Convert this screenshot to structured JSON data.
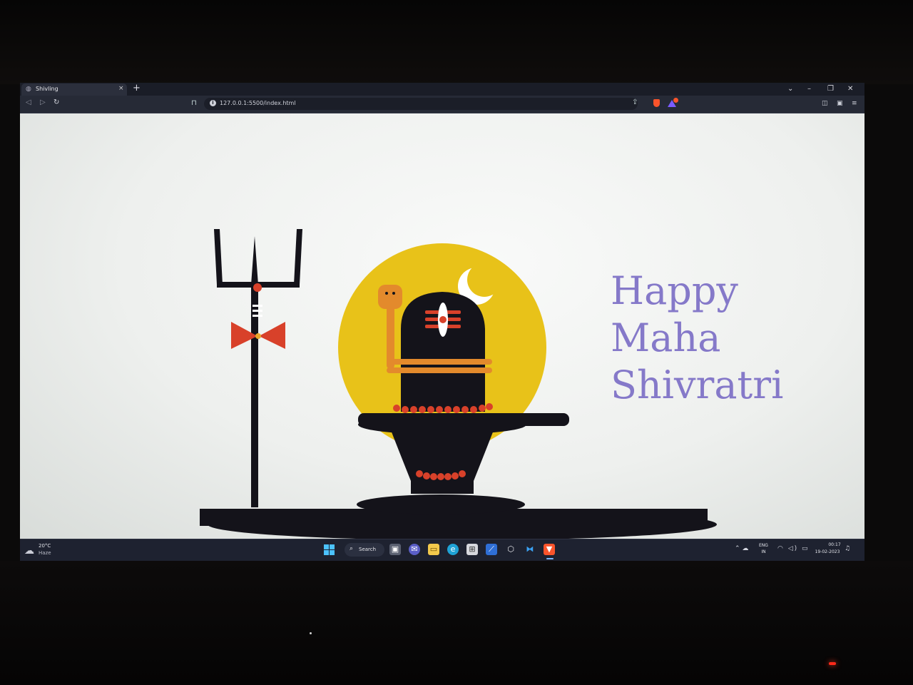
{
  "browser": {
    "tab_title": "Shivling",
    "tab_close": "×",
    "new_tab": "+",
    "url": "127.0.0.1:5500/index.html",
    "window_controls": [
      "⌄",
      "–",
      "❐",
      "✕"
    ],
    "nav": {
      "back": "◁",
      "forward": "▷",
      "reload": "↻"
    },
    "bookmark_glyph": "⊓",
    "share_glyph": "⇪",
    "sidebar_glyphs": [
      "◫",
      "▣",
      "≡"
    ]
  },
  "page": {
    "greeting_lines": [
      "Happy",
      "Maha",
      "Shivratri"
    ],
    "colors": {
      "greeting": "#8579c9",
      "sun": "#e8c219",
      "stone": "#14131a",
      "snake": "#e38a2c",
      "tilak_red": "#d8412a",
      "moon": "#ffffff"
    },
    "icons": [
      "trishul-icon",
      "damru-icon",
      "sun-disc",
      "crescent-moon-icon",
      "snake-icon",
      "shivling-stone",
      "rudraksha-beads"
    ]
  },
  "taskbar": {
    "weather_temp": "20°C",
    "weather_condition": "Haze",
    "search_label": "Search",
    "lang_top": "ENG",
    "lang_bottom": "IN",
    "time": "00:17",
    "date": "19-02-2023",
    "apps": [
      "task-view",
      "chat",
      "file-explorer",
      "edge",
      "store",
      "azure-data-studio",
      "unity",
      "vscode",
      "brave"
    ]
  }
}
